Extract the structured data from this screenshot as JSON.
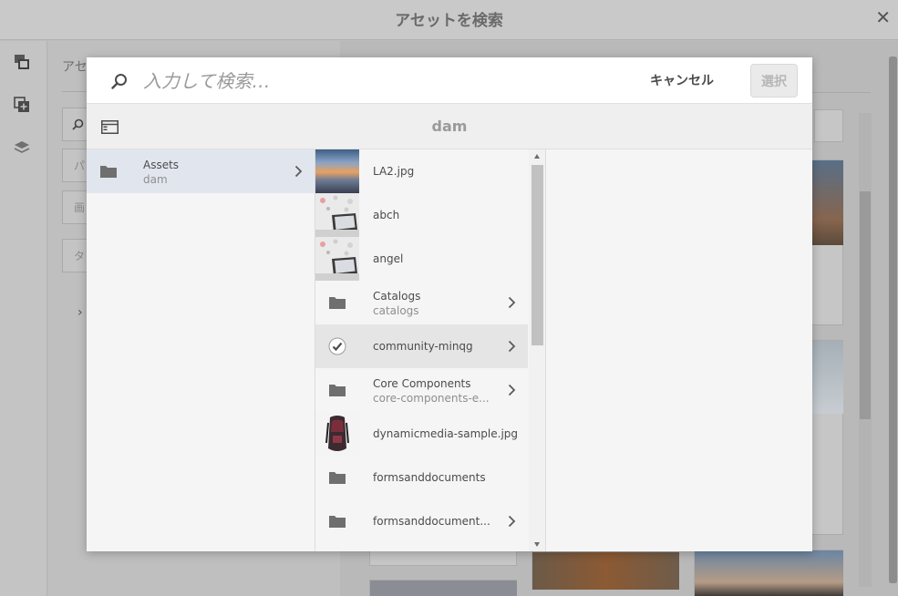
{
  "window": {
    "title": "アセットを検索",
    "close_icon": "close-icon"
  },
  "background": {
    "panel_title": "アセ",
    "fields": [
      "パ",
      "画",
      "タ"
    ],
    "rail_icons": [
      "filmstrip-icon",
      "add-collection-icon",
      "layers-icon"
    ]
  },
  "search": {
    "placeholder": "入力して検索…",
    "cancel_label": "キャンセル",
    "select_label": "選択"
  },
  "breadcrumb": {
    "title": "dam",
    "toggle_icon": "rail-toggle-icon"
  },
  "column1": {
    "items": [
      {
        "title": "Assets",
        "subtitle": "dam",
        "type": "folder",
        "has_children": true,
        "selected": true
      }
    ]
  },
  "column2": {
    "items": [
      {
        "title": "LA2.jpg",
        "subtitle": "",
        "type": "image",
        "thumb": "city-sunset",
        "has_children": false
      },
      {
        "title": "abch",
        "subtitle": "",
        "type": "image",
        "thumb": "tablet",
        "has_children": false
      },
      {
        "title": "angel",
        "subtitle": "",
        "type": "image",
        "thumb": "tablet",
        "has_children": false
      },
      {
        "title": "Catalogs",
        "subtitle": "catalogs",
        "type": "folder",
        "has_children": true
      },
      {
        "title": "community-minqg",
        "subtitle": "",
        "type": "checked",
        "has_children": true,
        "hover": true
      },
      {
        "title": "Core Components",
        "subtitle": "core-components-e...",
        "type": "folder",
        "has_children": true
      },
      {
        "title": "dynamicmedia-sample.jpg",
        "subtitle": "",
        "type": "image",
        "thumb": "backpack",
        "has_children": false
      },
      {
        "title": "formsanddocuments",
        "subtitle": "",
        "type": "folder",
        "has_children": false
      },
      {
        "title": "formsanddocument...",
        "subtitle": "",
        "type": "folder",
        "has_children": true
      }
    ]
  },
  "colors": {
    "accent_selected": "#e1e6ee",
    "overlay": "#bdbdbd"
  }
}
